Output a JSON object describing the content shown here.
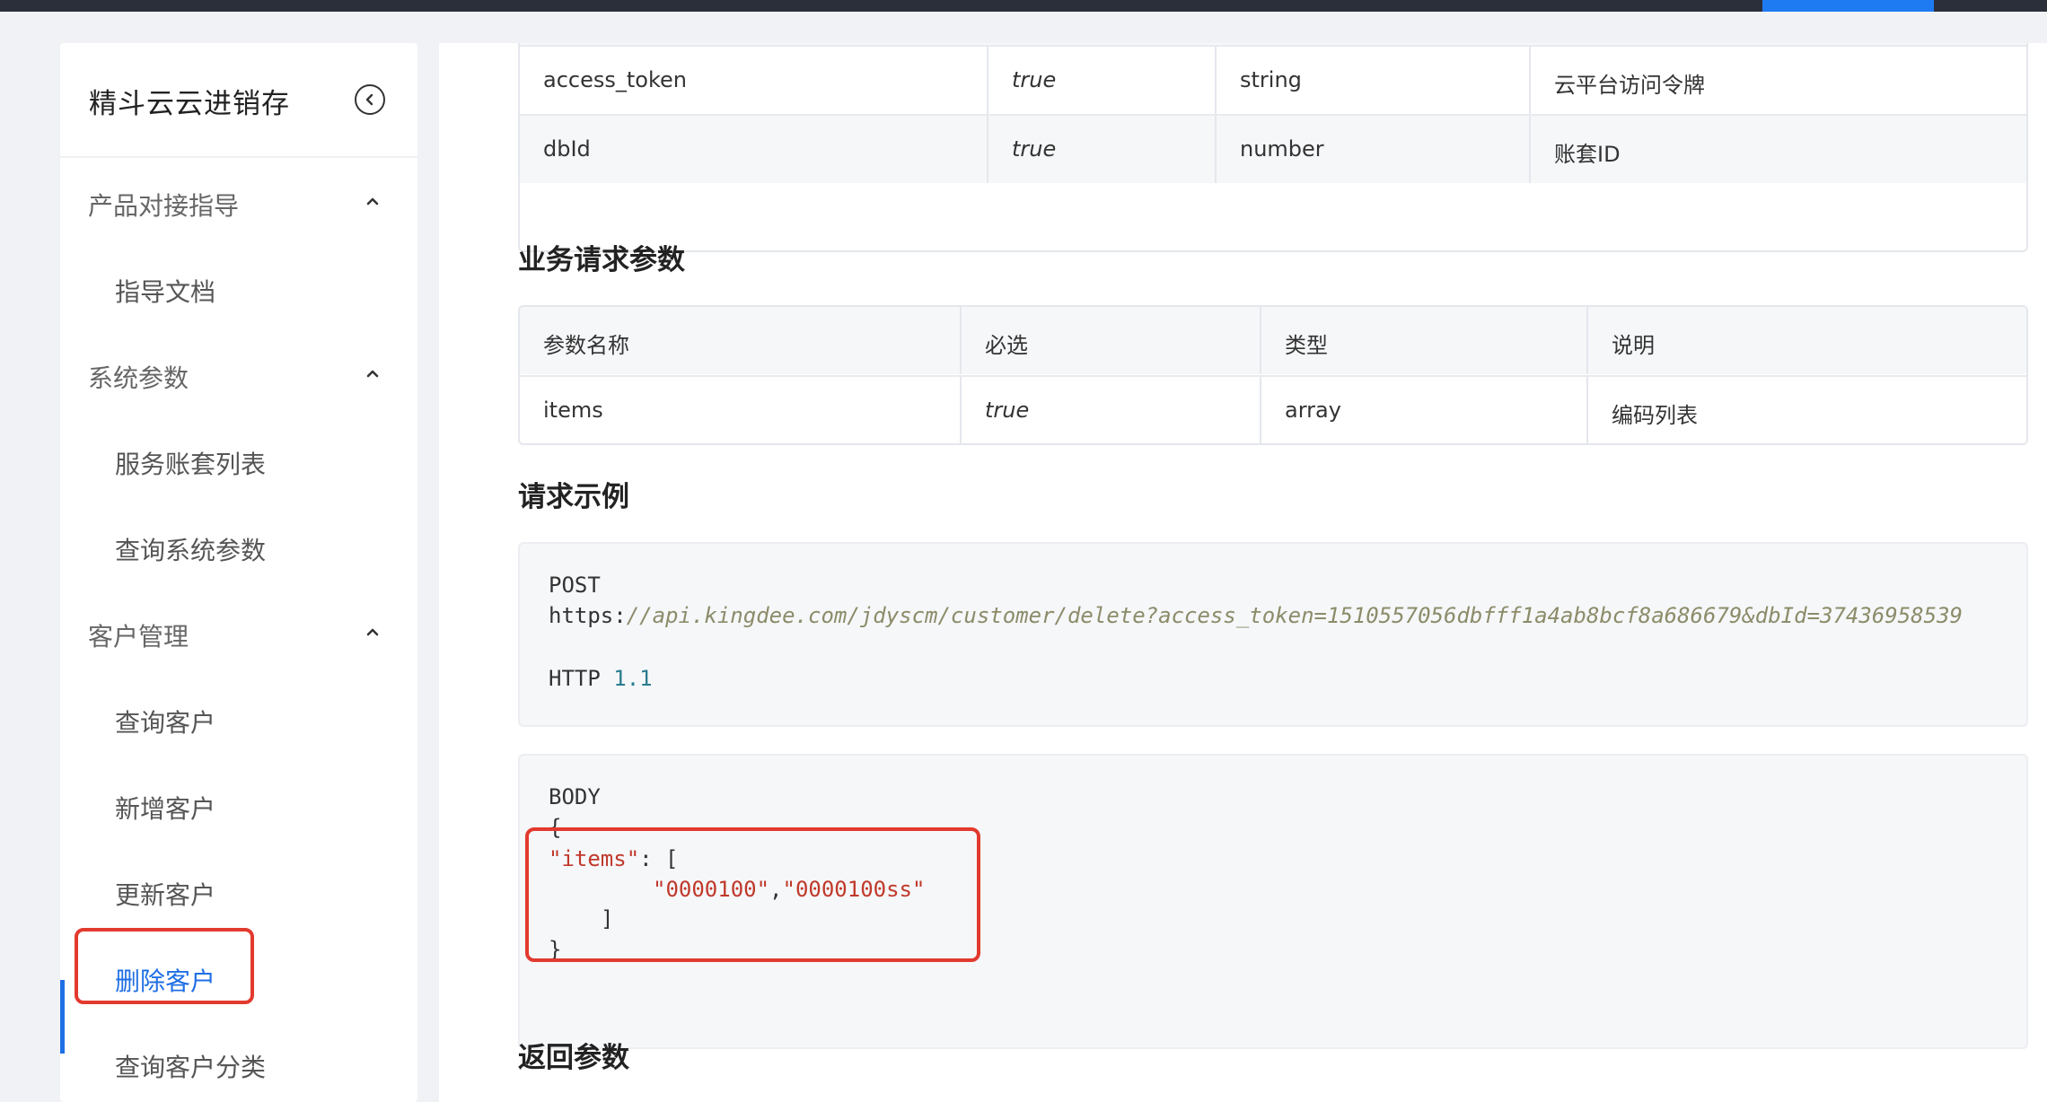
{
  "sidebar": {
    "title": "精斗云云进销存",
    "groups": [
      {
        "label": "产品对接指导",
        "items": [
          "指导文档"
        ]
      },
      {
        "label": "系统参数",
        "items": [
          "服务账套列表",
          "查询系统参数"
        ]
      },
      {
        "label": "客户管理",
        "items": [
          "查询客户",
          "新增客户",
          "更新客户",
          "删除客户",
          "查询客户分类"
        ]
      }
    ],
    "active_item": "删除客户"
  },
  "common_params": {
    "rows": [
      {
        "name": "access_token",
        "required": "true",
        "type": "string",
        "desc": "云平台访问令牌"
      },
      {
        "name": "dbId",
        "required": "true",
        "type": "number",
        "desc": "账套ID"
      }
    ]
  },
  "business_params": {
    "title": "业务请求参数",
    "headers": [
      "参数名称",
      "必选",
      "类型",
      "说明"
    ],
    "rows": [
      {
        "name": "items",
        "required": "true",
        "type": "array",
        "desc": "编码列表"
      }
    ]
  },
  "request_example": {
    "title": "请求示例",
    "method": "POST",
    "url_prefix": "https:",
    "url_rest": "//api.kingdee.com/jdyscm/customer/delete?access_token=1510557056dbfff1a4ab8bcf8a686679&dbId=37436958539",
    "http_label": "HTTP",
    "http_version": "1.1"
  },
  "body_example": {
    "label": "BODY",
    "open_brace": "{",
    "key": "\"items\"",
    "colon_bracket": ": [",
    "value1": "\"0000100\"",
    "comma": ",",
    "value2": "\"0000100ss\"",
    "close_bracket": "]",
    "close_brace": "}"
  },
  "return_params": {
    "title": "返回参数"
  },
  "colors": {
    "accent": "#1f6fe5",
    "highlight": "#e23a2e",
    "string": "#c0392b",
    "number": "#2a7c8e"
  }
}
